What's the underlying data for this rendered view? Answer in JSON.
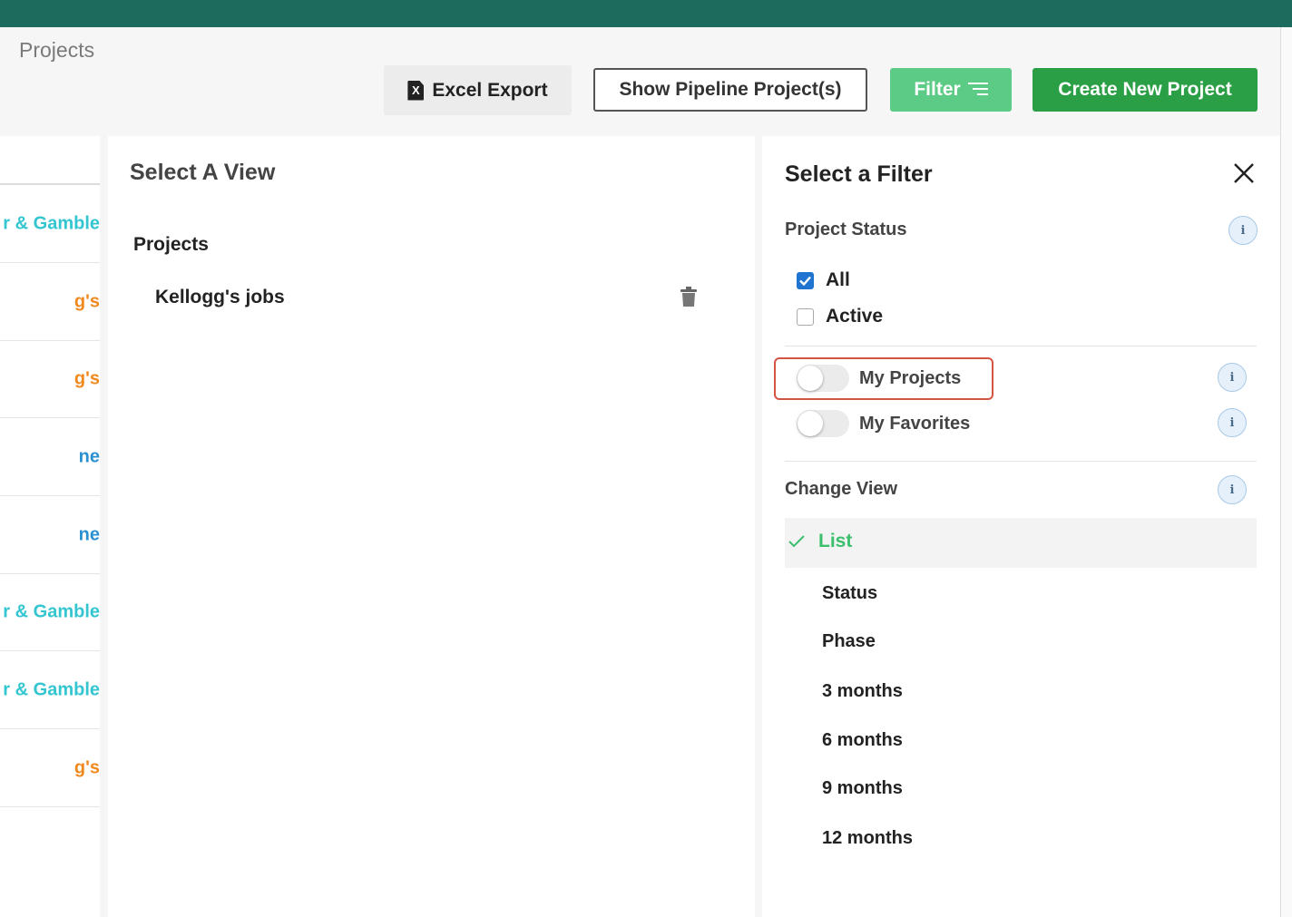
{
  "header": {
    "title": "Projects"
  },
  "toolbar": {
    "excel_export": "Excel Export",
    "excel_icon_letter": "X",
    "show_pipeline": "Show Pipeline Project(s)",
    "filter": "Filter",
    "create_new_project": "Create New Project"
  },
  "project_list": {
    "rows": [
      {
        "text": "r & Gamble",
        "color": "#33c6d1"
      },
      {
        "text": "g's",
        "color": "#f0881d"
      },
      {
        "text": "g's",
        "color": "#f0881d"
      },
      {
        "text": "ne",
        "color": "#2a90d0"
      },
      {
        "text": "ne",
        "color": "#2a90d0"
      },
      {
        "text": "r & Gamble",
        "color": "#33c6d1"
      },
      {
        "text": "r & Gamble",
        "color": "#33c6d1"
      },
      {
        "text": "g's",
        "color": "#f0881d"
      }
    ]
  },
  "view_panel": {
    "title": "Select A View",
    "section": "Projects",
    "items": [
      {
        "label": "Kellogg's jobs"
      }
    ]
  },
  "filter_panel": {
    "title": "Select a Filter",
    "project_status": {
      "label": "Project Status",
      "options": [
        {
          "label": "All",
          "checked": true
        },
        {
          "label": "Active",
          "checked": false
        }
      ]
    },
    "toggles": [
      {
        "label": "My Projects",
        "on": false
      },
      {
        "label": "My Favorites",
        "on": false
      }
    ],
    "change_view": {
      "label": "Change View",
      "selected": "List",
      "options": [
        "Status",
        "Phase",
        "3 months",
        "6 months",
        "9 months",
        "12 months"
      ]
    },
    "info_glyph": "i"
  },
  "colors": {
    "topbar": "#1d6b5c",
    "filter_button": "#5ccb85",
    "create_button": "#2b9f45",
    "highlight_outline": "#d45443",
    "selected_view": "#3bbf6e"
  }
}
